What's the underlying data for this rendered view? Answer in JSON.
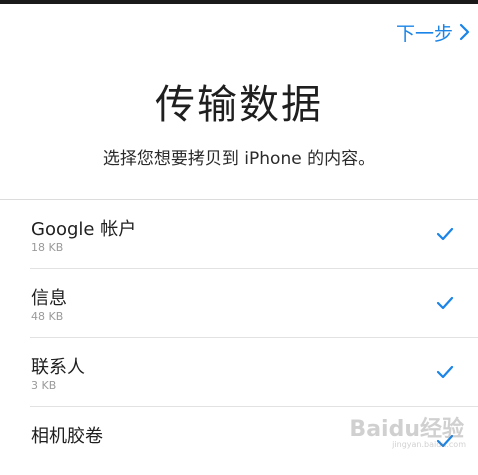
{
  "header": {
    "next_label": "下一步"
  },
  "title": "传输数据",
  "subtitle": "选择您想要拷贝到 iPhone 的内容。",
  "items": [
    {
      "name": "Google 帐户",
      "size": "18 KB",
      "checked": true
    },
    {
      "name": "信息",
      "size": "48 KB",
      "checked": true
    },
    {
      "name": "联系人",
      "size": "3 KB",
      "checked": true
    },
    {
      "name": "相机胶卷",
      "size": "",
      "checked": true
    }
  ],
  "watermark": {
    "text": "Baidu经验",
    "sub": "jingyan.baidu.com"
  },
  "colors": {
    "accent": "#1a84e8"
  }
}
